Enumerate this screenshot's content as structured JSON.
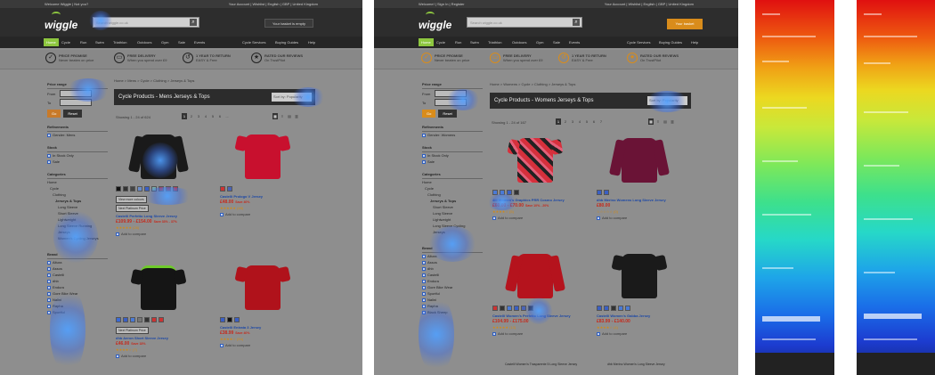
{
  "panels": [
    {
      "topbar": {
        "welcome": "Welcome Wiggle | Not you?",
        "account": "Your Account | Wishlist | English | GBP | United Kingdom"
      },
      "logo": "wiggle",
      "search_placeholder": "Search wiggle.co.uk",
      "basket": "Your basket is empty",
      "nav": [
        "Home",
        "Cycle",
        "Run",
        "Swim",
        "Triathlon",
        "Outdoors",
        "Gym",
        "Sale",
        "Events",
        "Cycle Services",
        "Buying Guides",
        "Help"
      ],
      "usps": [
        {
          "title": "PRICE PROMISE",
          "sub": "Never beaten on price"
        },
        {
          "title": "FREE DELIVERY",
          "sub": "When you spend over £9"
        },
        {
          "title": "1 YEAR TO RETURN",
          "sub": "EASY & Free"
        },
        {
          "title": "RATED OUR REVIEWS",
          "sub": "On TrustPilot"
        }
      ],
      "crumb": "Home > Mens > Cycle > Clothing > Jerseys & Tops",
      "title": "Cycle Products - Mens Jerseys & Tops",
      "sort": "Sort by: Popularity",
      "showing": "Showing 1 - 24 of 624",
      "pages": [
        "1",
        "2",
        "3",
        "4",
        "5",
        "6",
        "..."
      ],
      "refinements": "Refinements",
      "ref_item": "Gender: Mens",
      "stock": "Stock",
      "stock_items": [
        "In Stock Only",
        "Sale"
      ],
      "categories": "Categories",
      "cat_items": [
        "Home",
        "Cycle",
        "Clothing",
        "Jerseys & Tops",
        "Long Sleeve",
        "Short Sleeve",
        "Lightweight",
        "Long Sleeve Running",
        "Jerseys",
        "Women's Cycling Jerseys"
      ],
      "brand": "Brand",
      "brand_items": [
        "Altura",
        "Assos",
        "Castelli",
        "dhb",
        "Endura",
        "Gore Bike Wear",
        "Nalini",
        "Rapha",
        "Sportful"
      ],
      "price_range": "Price range",
      "from": "From",
      "to": "To",
      "go": "Go",
      "reset": "Reset",
      "products": [
        {
          "name": "Castelli Perfetto Long Sleeve Jersey",
          "price": "£109.99 - £154.00",
          "save": "Save 33% - 37%",
          "reviews": "(28)",
          "flag": "Next Platinum Price",
          "extra": "View more colours"
        },
        {
          "name": "Castelli Prologo V Jersey",
          "price": "£48.00",
          "save": "Save 40%",
          "reviews": "(48)"
        },
        {
          "name": "dhb Aeron Short Sleeve Jersey",
          "price": "£46.00",
          "save": "Save 18%",
          "reviews": "(7)",
          "flag": "Next Platinum Price"
        },
        {
          "name": "Castelli Entrata 3 Jersey",
          "price": "£38.99",
          "save": "Save 40%",
          "reviews": "(54)"
        }
      ],
      "compare": "Add to compare"
    },
    {
      "topbar": {
        "welcome": "Welcome! | Sign In | Register",
        "account": "Your Account | Wishlist | English | GBP | United Kingdom"
      },
      "logo": "wiggle",
      "search_placeholder": "Search wiggle.co.uk",
      "basket": "Your basket",
      "nav": [
        "Home",
        "Cycle",
        "Run",
        "Swim",
        "Triathlon",
        "Outdoors",
        "Gym",
        "Sale",
        "Events",
        "Cycle Services",
        "Buying Guides",
        "Help"
      ],
      "usps": [
        {
          "title": "PRICE PROMISE",
          "sub": "Never beaten on price"
        },
        {
          "title": "FREE DELIVERY",
          "sub": "When you spend over £9"
        },
        {
          "title": "1 YEAR TO RETURN",
          "sub": "EASY & Free"
        },
        {
          "title": "RATED OUR REVIEWS",
          "sub": "On TrustPilot"
        }
      ],
      "crumb": "Home > Womens > Cycle > Clothing > Jerseys & Tops",
      "title": "Cycle Products - Womens Jerseys & Tops",
      "sort": "Sort by: Popularity",
      "showing": "Showing 1 - 24 of 167",
      "pages": [
        "1",
        "2",
        "3",
        "4",
        "5",
        "6",
        "7"
      ],
      "refinements": "Refinements",
      "ref_item": "Gender: Womens",
      "stock": "Stock",
      "stock_items": [
        "In Stock Only",
        "Sale"
      ],
      "categories": "Categories",
      "cat_items": [
        "Home",
        "Cycle",
        "Clothing",
        "Jerseys & Tops",
        "Short Sleeve",
        "Long Sleeve",
        "Lightweight",
        "Long Sleeve Cycling",
        "Jerseys"
      ],
      "brand": "Brand",
      "brand_items": [
        "Altura",
        "Assos",
        "dhb",
        "Castelli",
        "Endura",
        "Gore Bike Wear",
        "Sportful",
        "Nalini",
        "Rapha",
        "Black Sheep"
      ],
      "price_range": "Price range",
      "from": "From",
      "to": "To",
      "go": "Go",
      "reset": "Reset",
      "products": [
        {
          "name": "4iii Women's Graphics PRR Cosmo Jersey",
          "price": "£60.00 - £70.00",
          "save": "Save 10% - 20%",
          "reviews": "(5)"
        },
        {
          "name": "dhb Merino Womens Long Sleeve Jersey",
          "price": "£80.00",
          "save": "",
          "reviews": "(0)"
        },
        {
          "name": "Castelli Women's Perfetto Long Sleeve Jersey",
          "price": "£104.99 - £175.00",
          "save": "",
          "reviews": "(13)"
        },
        {
          "name": "Castelli Women's Gabba Jersey",
          "price": "£83.99 - £140.00",
          "save": "",
          "reviews": "(4)"
        }
      ],
      "more": [
        "Castelli Women's Trasparente 5 Long Sleeve Jersey",
        "dhb Merino Women's Long Sleeve Jersey"
      ],
      "compare": "Add to compare"
    }
  ],
  "colors": {
    "accent": "#8dc63f",
    "price": "#c52a1c",
    "link": "#1b47a6",
    "header": "#2d2d2d",
    "orange": "#d98c1b"
  }
}
